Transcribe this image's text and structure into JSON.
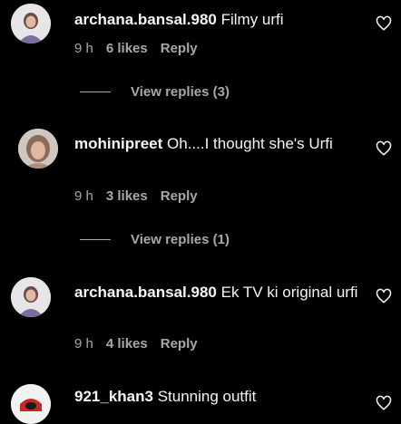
{
  "comments": [
    {
      "username": "archana.bansal.980",
      "text": "Filmy urfi",
      "time": "9 h",
      "likes": "6 likes",
      "reply": "Reply",
      "view_replies": "View replies (3)"
    },
    {
      "username": "mohinipreet",
      "text": "Oh....I thought she's Urfi",
      "time": "9 h",
      "likes": "3 likes",
      "reply": "Reply",
      "view_replies": "View replies (1)"
    },
    {
      "username": "archana.bansal.980",
      "text": "Ek TV ki original urfi",
      "time": "9 h",
      "likes": "4 likes",
      "reply": "Reply"
    },
    {
      "username": "921_khan3",
      "text": "Stunning outfit"
    }
  ],
  "icons": {
    "like": "heart-outline-icon"
  }
}
